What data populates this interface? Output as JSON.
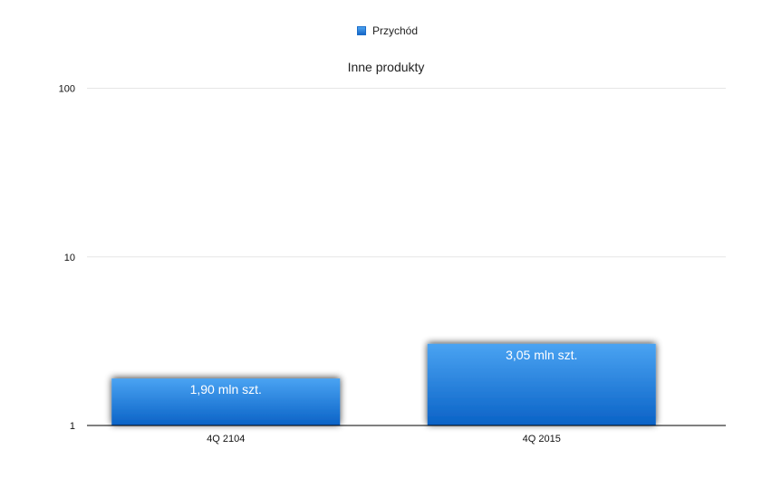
{
  "chart_data": {
    "type": "bar",
    "title": "Inne produkty",
    "xlabel": "",
    "ylabel": "",
    "yscale": "log",
    "ylim": [
      1,
      100
    ],
    "yticks": [
      1,
      10,
      100
    ],
    "ytick_labels": [
      "1",
      "10",
      "100"
    ],
    "categories": [
      "4Q 2104",
      "4Q 2015"
    ],
    "series": [
      {
        "name": "Przychód",
        "values": [
          1.9,
          3.05
        ],
        "data_labels": [
          "1,90 mln szt.",
          "3,05 mln szt."
        ]
      }
    ],
    "legend": "top-center",
    "grid": true,
    "colors": {
      "bar_top": "#4aa3f2",
      "bar_bottom": "#0a62c6",
      "grid": "#e6e6e6",
      "axis": "#000000",
      "label": "#ffffff"
    }
  }
}
